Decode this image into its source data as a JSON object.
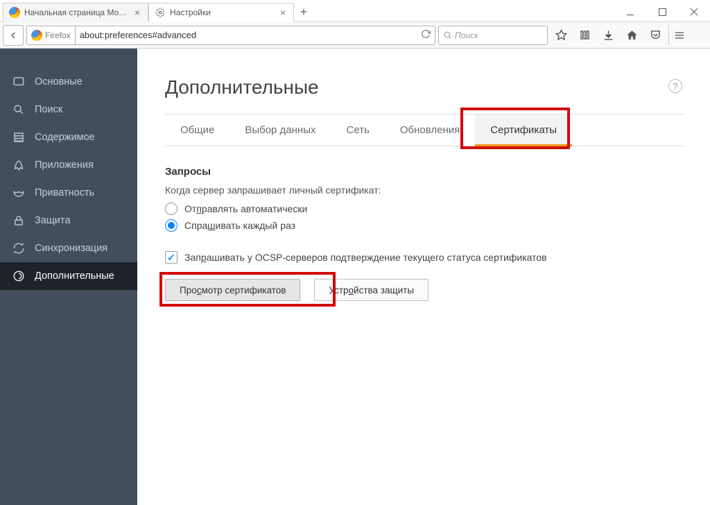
{
  "window": {
    "tabs": [
      {
        "title": "Начальная страница Mozill",
        "active": false
      },
      {
        "title": "Настройки",
        "active": true
      }
    ]
  },
  "toolbar": {
    "identity_label": "Firefox",
    "url": "about:preferences#advanced",
    "search_placeholder": "Поиск"
  },
  "sidebar": {
    "items": [
      {
        "label": "Основные"
      },
      {
        "label": "Поиск"
      },
      {
        "label": "Содержимое"
      },
      {
        "label": "Приложения"
      },
      {
        "label": "Приватность"
      },
      {
        "label": "Защита"
      },
      {
        "label": "Синхронизация"
      },
      {
        "label": "Дополнительные"
      }
    ],
    "active_index": 7
  },
  "page": {
    "title": "Дополнительные",
    "subtabs": [
      "Общие",
      "Выбор данных",
      "Сеть",
      "Обновления",
      "Сертификаты"
    ],
    "active_subtab": 4,
    "section_title": "Запросы",
    "prompt_text": "Когда сервер запрашивает личный сертификат:",
    "radio_auto": "Отправлять автоматически",
    "radio_ask": "Спрашивать каждый раз",
    "radio_selected": "ask",
    "ocsp_label": "Запрашивать у OCSP-серверов подтверждение текущего статуса сертификатов",
    "ocsp_checked": true,
    "btn_view_certs": "Просмотр сертификатов",
    "btn_security_devices": "Устройства защиты"
  }
}
